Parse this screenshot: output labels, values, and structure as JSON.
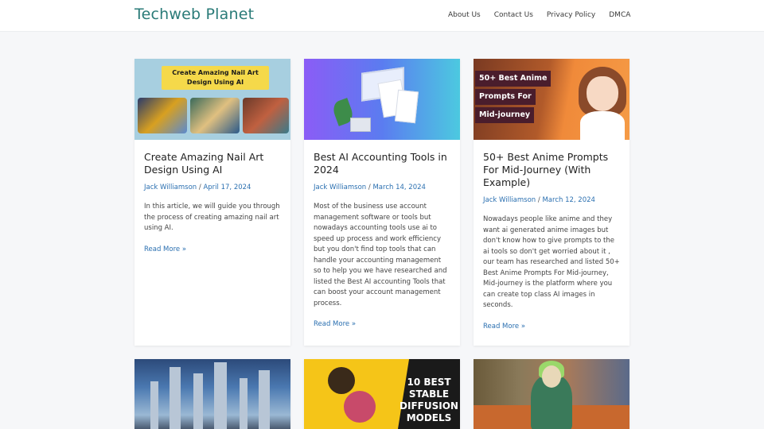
{
  "header": {
    "site_title": "Techweb Planet",
    "nav": [
      "About Us",
      "Contact Us",
      "Privacy Policy",
      "DMCA"
    ]
  },
  "posts": [
    {
      "title": "Create Amazing Nail Art Design Using AI",
      "thumb_text": "Create Amazing Nail Art Design Using AI",
      "author": "Jack Williamson",
      "date": "April 17, 2024",
      "excerpt": "In this article, we will guide you through the process of creating amazing nail art using AI.",
      "read_more": "Read More »"
    },
    {
      "title": "Best AI Accounting Tools in 2024",
      "author": "Jack Williamson",
      "date": "March 14, 2024",
      "excerpt": "Most of the business use account management software or tools but nowadays accounting tools use ai to speed up process and work efficiency but you don't find top tools that can handle your accounting management so to help you we have researched and listed the Best AI accounting Tools that can boost your account management process.",
      "read_more": "Read More »"
    },
    {
      "title": "50+ Best Anime Prompts For Mid-Journey (With Example)",
      "thumb_labels": [
        "50+ Best Anime",
        "Prompts For",
        "Mid-journey"
      ],
      "author": "Jack Williamson",
      "date": "March 12, 2024",
      "excerpt": "Nowadays people like anime and they want ai generated anime images but don't know how to give prompts to the ai tools so don't get worried about it , our team has researched and listed 50+ Best Anime Prompts For Mid-journey, Mid-journey is the platform where you can create top class AI images in seconds.",
      "read_more": "Read More »"
    }
  ],
  "bottom_thumbs": {
    "stable_diffusion_text": "10 BEST STABLE DIFFUSION MODELS"
  },
  "colors": {
    "accent": "#2a7b78",
    "link": "#2a6fb0",
    "background": "#f6f7f9"
  }
}
